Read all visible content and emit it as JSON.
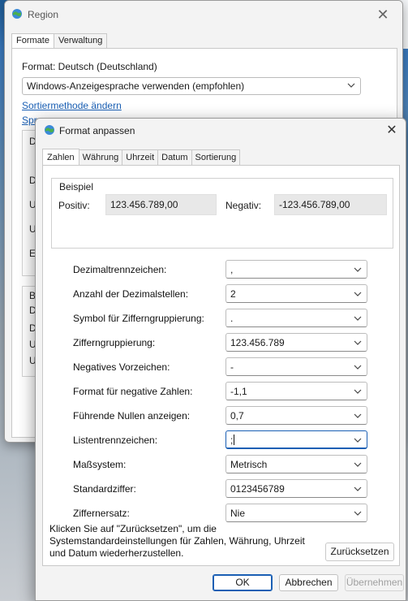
{
  "region_window": {
    "title": "Region",
    "tabs": [
      "Formate",
      "Verwaltung"
    ],
    "format_label": "Format: Deutsch (Deutschland)",
    "display_language_select": "Windows-Anzeigesprache verwenden (empfohlen)",
    "sort_link": "Sortiermethode ändern",
    "lang_link_partial": "Spr",
    "group_rows_top": [
      "D",
      "D",
      "U",
      "U",
      "E"
    ],
    "group_rows_bottom": [
      "B",
      "D",
      "D",
      "U",
      "U"
    ]
  },
  "dialog": {
    "title": "Format anpassen",
    "tabs": [
      "Zahlen",
      "Währung",
      "Uhrzeit",
      "Datum",
      "Sortierung"
    ],
    "sample": {
      "legend": "Beispiel",
      "positive_label": "Positiv:",
      "positive_value": "123.456.789,00",
      "negative_label": "Negativ:",
      "negative_value": "-123.456.789,00"
    },
    "fields": [
      {
        "label": "Dezimaltrennzeichen:",
        "value": ","
      },
      {
        "label": "Anzahl der Dezimalstellen:",
        "value": "2"
      },
      {
        "label": "Symbol für Zifferngruppierung:",
        "value": "."
      },
      {
        "label": "Zifferngruppierung:",
        "value": "123.456.789"
      },
      {
        "label": "Negatives Vorzeichen:",
        "value": "-"
      },
      {
        "label": "Format für negative Zahlen:",
        "value": "-1,1"
      },
      {
        "label": "Führende Nullen anzeigen:",
        "value": "0,7"
      },
      {
        "label": "Listentrennzeichen:",
        "value": ";"
      },
      {
        "label": "Maßsystem:",
        "value": "Metrisch"
      },
      {
        "label": "Standardziffer:",
        "value": "0123456789"
      },
      {
        "label": "Ziffernersatz:",
        "value": "Nie"
      }
    ],
    "help_text": "Klicken Sie auf \"Zurücksetzen\", um die Systemstandardeinstellungen für Zahlen, Währung, Uhrzeit und Datum wiederherzustellen.",
    "reset_label": "Zurücksetzen",
    "ok_label": "OK",
    "cancel_label": "Abbrechen",
    "apply_label": "Übernehmen"
  },
  "colors": {
    "accent": "#1a5fb4",
    "disabled_text": "#a0a0a0"
  }
}
